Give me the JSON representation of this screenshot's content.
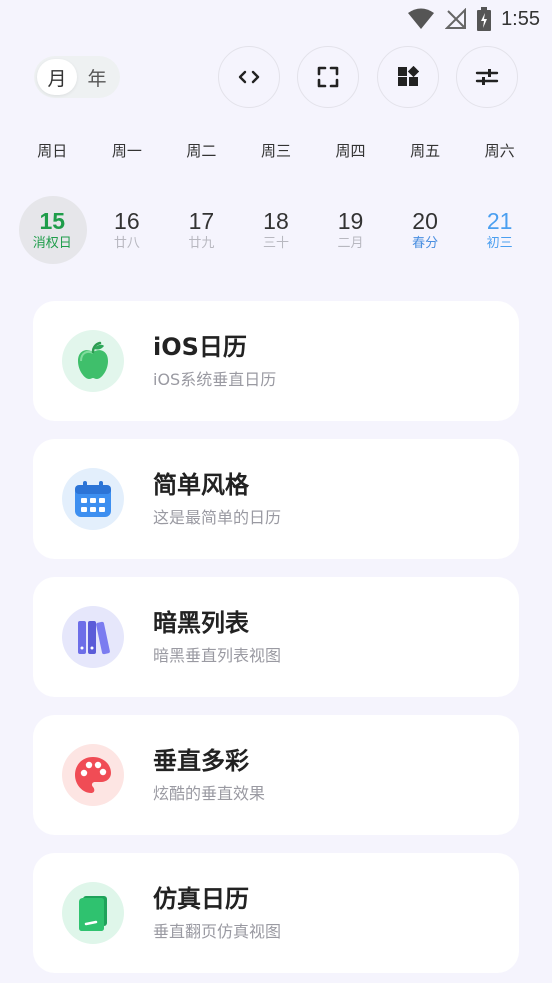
{
  "status": {
    "time": "1:55"
  },
  "toggle": {
    "month": "月",
    "year": "年"
  },
  "weekdays": [
    "周日",
    "周一",
    "周二",
    "周三",
    "周四",
    "周五",
    "周六"
  ],
  "dates": [
    {
      "day": "15",
      "sub": "消权日"
    },
    {
      "day": "16",
      "sub": "廿八"
    },
    {
      "day": "17",
      "sub": "廿九"
    },
    {
      "day": "18",
      "sub": "三十"
    },
    {
      "day": "19",
      "sub": "二月"
    },
    {
      "day": "20",
      "sub": "春分"
    },
    {
      "day": "21",
      "sub": "初三"
    }
  ],
  "cards": [
    {
      "title": "iOS日历",
      "desc": "iOS系统垂直日历",
      "icon": "apple-icon"
    },
    {
      "title": "简单风格",
      "desc": "这是最简单的日历",
      "icon": "calendar-icon"
    },
    {
      "title": "暗黑列表",
      "desc": "暗黑垂直列表视图",
      "icon": "books-icon"
    },
    {
      "title": "垂直多彩",
      "desc": "炫酷的垂直效果",
      "icon": "palette-icon"
    },
    {
      "title": "仿真日历",
      "desc": "垂直翻页仿真视图",
      "icon": "book-icon"
    }
  ],
  "colors": {
    "background": "#f5f4fd",
    "today": "#1f9d4a",
    "saturday": "#4b9ff0",
    "festival": "#4b8fe0"
  }
}
